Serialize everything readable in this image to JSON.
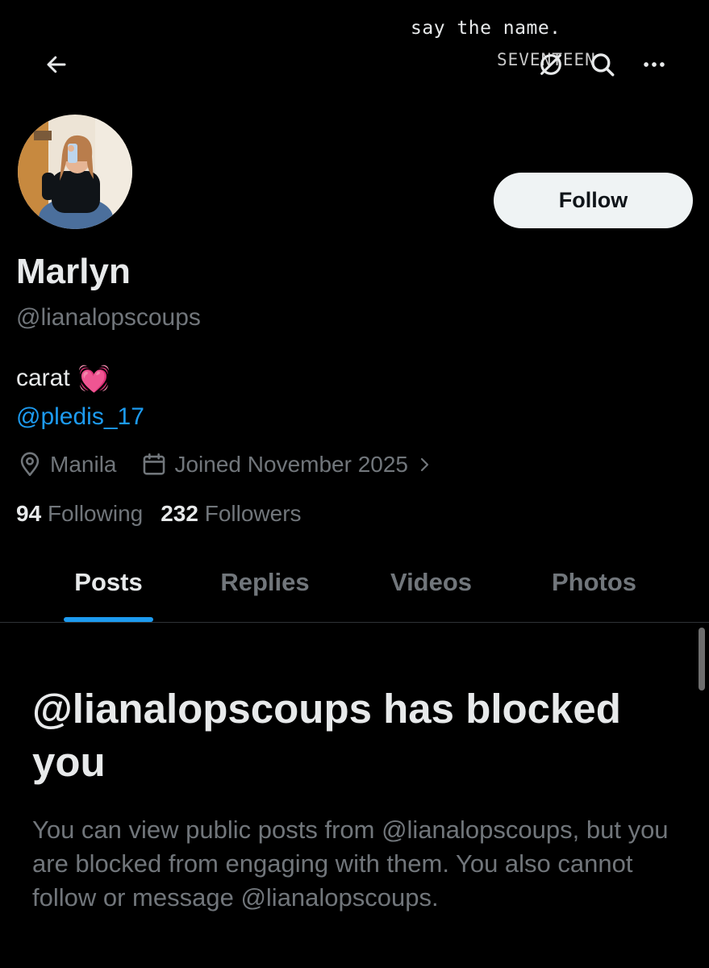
{
  "watermark": {
    "top_line": "say the name.",
    "brand": "SEVENTEEN"
  },
  "icons": {
    "back": "back-arrow-icon",
    "alert": "bell-slash-icon",
    "search": "search-icon",
    "more": "more-horizontal-icon",
    "location": "location-pin-icon",
    "calendar": "calendar-icon",
    "chevron": "chevron-right-icon"
  },
  "profile": {
    "display_name": "Marlyn",
    "handle": "@lianalopscoups",
    "bio_text": "carat",
    "bio_emoji": "💓",
    "bio_mention": "@pledis_17",
    "location": "Manila",
    "joined": "Joined November 2025",
    "following_count": "94",
    "following_label": "Following",
    "followers_count": "232",
    "followers_label": "Followers"
  },
  "actions": {
    "follow_label": "Follow"
  },
  "tabs": [
    {
      "label": "Posts",
      "active": true
    },
    {
      "label": "Replies",
      "active": false
    },
    {
      "label": "Videos",
      "active": false
    },
    {
      "label": "Photos",
      "active": false
    }
  ],
  "blocked": {
    "title": "@lianalopscoups has blocked you",
    "body": "You can view public posts from @lianalopscoups, but you are blocked from engaging with them. You also cannot follow or message @lianalopscoups."
  },
  "colors": {
    "background": "#000000",
    "accent": "#1d9bf0",
    "primary_text": "#e7e9ea",
    "secondary_text": "#71767b"
  }
}
